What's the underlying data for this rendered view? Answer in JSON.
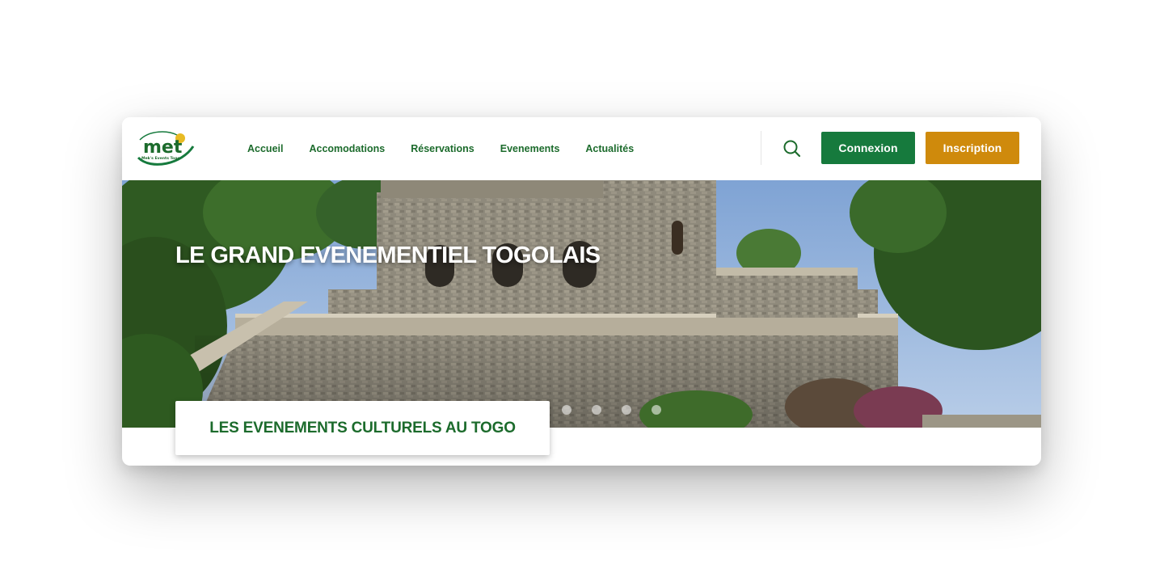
{
  "brand": {
    "logo_text": "met",
    "tagline": "Mek's Events Togo"
  },
  "nav": {
    "items": [
      {
        "label": "Accueil",
        "active": true
      },
      {
        "label": "Accomodations",
        "active": false
      },
      {
        "label": "Réservations",
        "active": false
      },
      {
        "label": "Evenements",
        "active": false
      },
      {
        "label": "Actualités",
        "active": false
      }
    ]
  },
  "actions": {
    "search_icon": "search-icon",
    "login_label": "Connexion",
    "signup_label": "Inscription"
  },
  "hero": {
    "title": "LE GRAND EVENEMENTIEL TOGOLAIS",
    "slide_count": 4
  },
  "banner": {
    "text": "LES EVENEMENTS CULTURELS AU TOGO"
  },
  "colors": {
    "primary_green": "#167a3d",
    "accent_gold": "#cf8a0c",
    "text_green": "#1c6b2c"
  }
}
